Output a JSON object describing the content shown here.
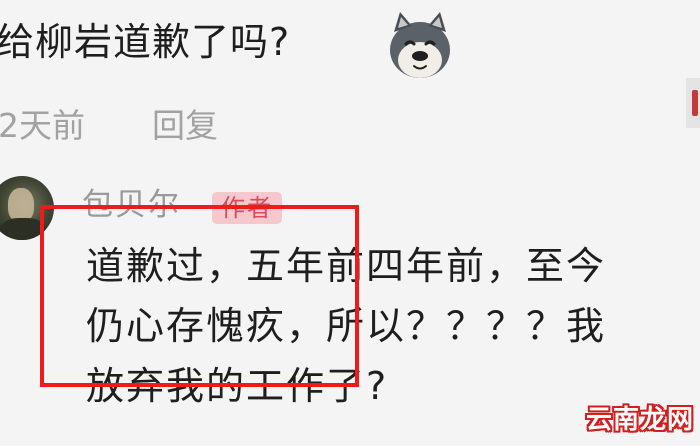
{
  "parent_comment": {
    "text": "给柳岩道歉了吗?",
    "emoji": "dog-face-emoji",
    "time": "2天前",
    "reply_label": "回复"
  },
  "reply_comment": {
    "username": "包贝尔",
    "badge": "作者",
    "lines": [
      "道歉过，五年前四年前，至今",
      "仍心存愧疚，所以？？？？我",
      "放弃我的工作了?"
    ]
  },
  "highlight_color": "#ef1a1a",
  "watermark": "云南龙网"
}
